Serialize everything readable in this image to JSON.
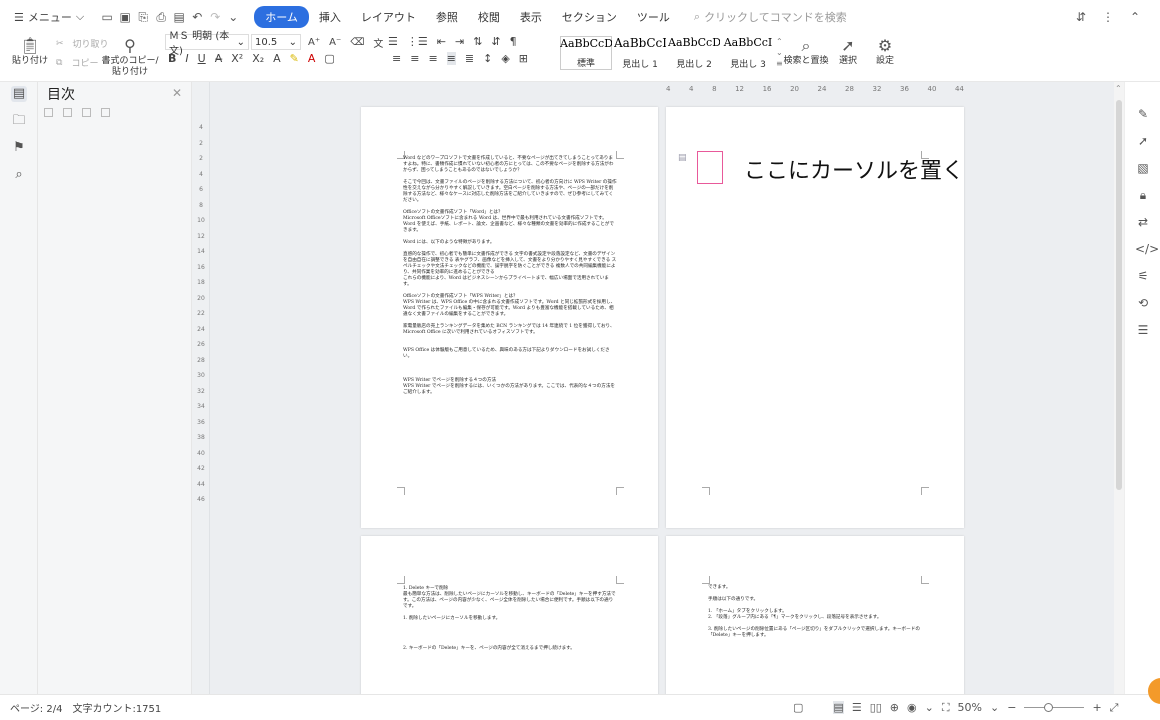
{
  "menubar": {
    "menu_label": "メニュー",
    "tabs": [
      {
        "label": "ホーム",
        "active": true
      },
      {
        "label": "挿入"
      },
      {
        "label": "レイアウト"
      },
      {
        "label": "参照"
      },
      {
        "label": "校閲"
      },
      {
        "label": "表示"
      },
      {
        "label": "セクション"
      },
      {
        "label": "ツール"
      }
    ],
    "search_placeholder": "クリックしてコマンドを検索"
  },
  "ribbon": {
    "paste": "貼り付け",
    "cut": "切り取り",
    "copy": "コピー",
    "format_copy": "書式のコピー/\n貼り付け",
    "font_name": "ＭＳ 明朝 (本文)",
    "font_size": "10.5",
    "styles": [
      {
        "preview": "AaBbCcDd",
        "label": "標準",
        "active": true
      },
      {
        "preview": "AaBbCcI",
        "label": "見出し 1"
      },
      {
        "preview": "AaBbCcDd",
        "label": "見出し 2"
      },
      {
        "preview": "AaBbCcI",
        "label": "見出し 3"
      }
    ],
    "find_replace": "検索と置換",
    "select": "選択",
    "settings": "設定"
  },
  "toc": {
    "title": "目次"
  },
  "ruler": {
    "horizontal": [
      "4",
      "4",
      "8",
      "12",
      "16",
      "20",
      "24",
      "28",
      "32",
      "36",
      "40",
      "44"
    ],
    "vertical": [
      "4",
      "2",
      "2",
      "4",
      "6",
      "8",
      "10",
      "12",
      "14",
      "16",
      "18",
      "20",
      "22",
      "24",
      "26",
      "28",
      "30",
      "32",
      "34",
      "36",
      "38",
      "40",
      "42",
      "44",
      "46"
    ]
  },
  "page1": {
    "paragraphs": [
      "Word などのワープロソフトで文書を作成していると、不要なページが出てきてしまうことってありますよね。特に、書類作成に慣れていない初心者の方にとっては、この不要なページを削除する方法がわからず、困ってしまうこともあるのではないでしょうか？",
      "そこで今回は、文書ファイルのページを削除する方法について、初心者の方向けに WPS Writer の操作性を交えながら分かりやすく解説していきます。空白ページを削除する方法や、ページの一部だけを削除する方法など、様々なケースに対応した削除方法をご紹介していきますので、ぜひ参考にしてみてください。",
      "Officeソフトの文書作成ソフト「Word」とは？\nMicrosoft Officeソフトに含まれる Word は、世界中で最も利用されている文書作成ソフトです。Word を使えば、手紙、レポート、論文、企画書など、様々な種類の文書を効率的に作成することができます。",
      "Word には、以下のような特徴があります。",
      "直感的な操作で、初心者でも簡単に文書作成ができる 文字の書式設定や段落設定など、文書のデザインを自由自在に調整できる 表やグラフ、画像などを挿入して、文書をより分かりやすく見やすくできる スペルチェックや文法チェックなどの機能で、誤字脱字を防ぐことができる 複数人での共同編集機能により、共同作業を効率的に進めることができる\nこれらの機能により、Word はビジネスシーンからプライベートまで、幅広い場面で活用されています。",
      "Officeソフトの文書作成ソフト「WPS Writer」とは？\nWPS Writer は、WPS Office の中に含まれる文書作成ソフトです。Word と同じ拡張形式を採用し、Word で作られたファイルも編集・保存が可能です。Word よりも豊富な機能を搭載しているため、相違なく文書ファイルの編集をすることができます。",
      "家電量販店の売上ランキングデータを集めた BCN ランキングでは 14 年連続で 1 位を獲得しており、Microsoft Office に次いで利用されているオフィスソフトです。",
      "\nWPS Office は体験版もご用意しているため、興味のある方は下記よりダウンロードをお試しください。",
      "\n\nWPS Writer でページを削除する４つの方法\nWPS Writer でページを削除するには、いくつかの方法があります。ここでは、代表的な４つの方法をご紹介します。"
    ]
  },
  "page2": {
    "callout": "ここにカーソルを置く"
  },
  "page3": {
    "paragraphs": [
      "1. Delete キーで削除\n最も簡単な方法は、削除したいページにカーソルを移動し、キーボードの「Delete」キーを押す方法です。この方法は、ページの内容が少なく、ページ全体を削除したい場合に便利です。手順は以下の通りです。",
      "1. 削除したいページにカーソルを移動します。",
      "\n\n\n2. キーボードの「Delete」キーを、ページの内容が全て消えるまで押し続けます。"
    ]
  },
  "page4": {
    "paragraphs": [
      "できます。",
      "手順は以下の通りです。",
      "1. 「ホーム」タブをクリックします。\n2. 「段落」グループ内にある「¶」マークをクリックし、段落記号を表示させます。",
      "3. 削除したいページの削除位置にある「ページ区切り」をダブルクリックで選択します。キーボードの「Delete」キーを押します。"
    ]
  },
  "status": {
    "page": "ページ: 2/4",
    "word_count": "文字カウント:1751",
    "zoom": "50%"
  }
}
